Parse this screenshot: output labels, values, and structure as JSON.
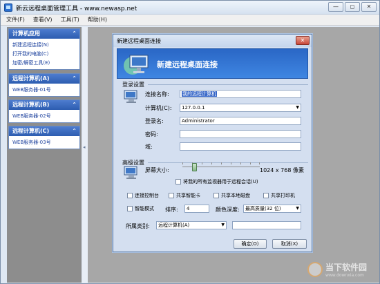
{
  "window": {
    "title": "新云远程桌面管理工具 - www.newasp.net",
    "buttons": [
      "—",
      "◻",
      "✕"
    ]
  },
  "menu": [
    "文件(F)",
    "查看(V)",
    "工具(T)",
    "帮助(H)"
  ],
  "sidebar": {
    "groups": [
      {
        "title": "计算机应用",
        "items": [
          "新建远程连接(N)",
          "打开我的电脑(C)",
          "加密/解密工具(E)"
        ]
      },
      {
        "title": "远程计算机(A)",
        "items": [
          "WEB服务器-01号"
        ]
      },
      {
        "title": "远程计算机(B)",
        "items": [
          "WEB服务器-02号"
        ]
      },
      {
        "title": "远程计算机(C)",
        "items": [
          "WEB服务器-03号"
        ]
      }
    ]
  },
  "dialog": {
    "title": "新建远程桌面连接",
    "close": "✕",
    "banner_title": "新建远程桌面连接",
    "login_section": "登录设置",
    "fields": {
      "name_label": "连接名称:",
      "name_value": "我的远程计算机",
      "computer_label": "计算机(C):",
      "computer_value": "127.0.0.1",
      "user_label": "登录名:",
      "user_value": "Administrator",
      "password_label": "密码:",
      "domain_label": "域:"
    },
    "advanced_section": "高级设置",
    "screen_label": "屏幕大小:",
    "screen_value": "1024 x 768 像素",
    "screen_level": 0.15,
    "multimonitor": "将我的所有监视器用于远程会话(U)",
    "checks": {
      "console": "连接控制台",
      "smartcard": "共享智能卡",
      "disk": "共享本地磁盘",
      "printer": "共享打印机",
      "smartmode": "智能模式"
    },
    "order_label": "排序:",
    "order_value": "4",
    "depth_label": "颜色深度:",
    "depth_value": "最高质量(32 位)",
    "category_label": "所属类别:",
    "category_value": "远程计算机(A)",
    "ok": "确定(O)",
    "cancel": "取消(X)"
  },
  "watermark": {
    "title": "当下软件园",
    "subtitle": "www.downxia.com"
  }
}
